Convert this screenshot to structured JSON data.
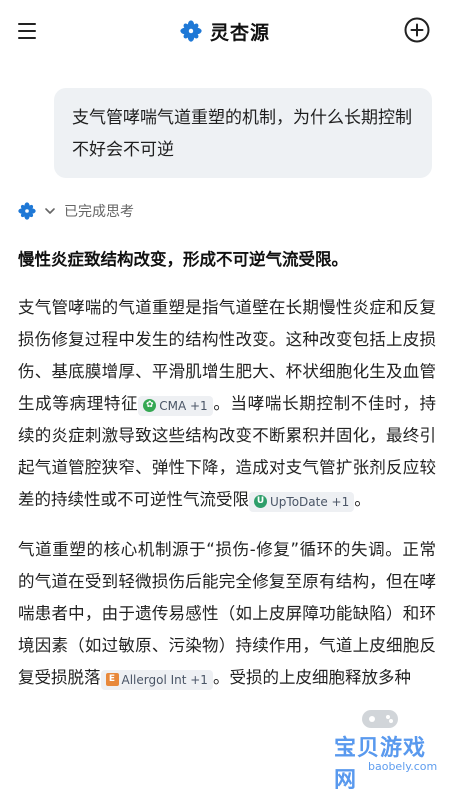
{
  "header": {
    "app_name": "灵杏源",
    "menu_icon": "hamburger-menu-icon",
    "logo_icon": "flower-logo-icon",
    "new_chat_icon": "new-chat-plus-icon",
    "accent_color": "#1e78d6"
  },
  "user_message": {
    "text": "支气管哮喘气道重塑的机制，为什么长期控制不好会不可逆"
  },
  "thinking": {
    "label": "已完成思考",
    "chevron_icon": "chevron-down-icon"
  },
  "answer": {
    "lead": "慢性炎症致结构改变，形成不可逆气流受限。",
    "p1_part1": "支气管哮喘的气道重塑是指气道壁在长期慢性炎症和反复损伤修复过程中发生的结构性改变。这种改变包括上皮损伤、基底膜增厚、平滑肌增生肥大、杯状细胞化生及血管生成等病理特征",
    "cite1": "CMA +1",
    "p1_part2": "。当哮喘长期控制不佳时，持续的炎症刺激导致这些结构改变不断累积并固化，最终引起气道管腔狭窄、弹性下降，造成对支气管扩张剂反应较差的持续性或不可逆性气流受限",
    "cite2": "UpToDate +1",
    "p1_part3": "。",
    "p2_part1": "气道重塑的核心机制源于“损伤-修复”循环的失调。正常的气道在受到轻微损伤后能完全修复至原有结构，但在哮喘患者中，由于遗传易感性（如上皮屏障功能缺陷）和环境因素（如过敏原、污染物）持续作用，气道上皮细胞反复受损脱落",
    "cite3": "Allergol Int +1",
    "p2_part2": "。受损的上皮细胞释放多种"
  },
  "watermark": {
    "text": "宝贝游戏网",
    "sub": "baobely.com"
  }
}
